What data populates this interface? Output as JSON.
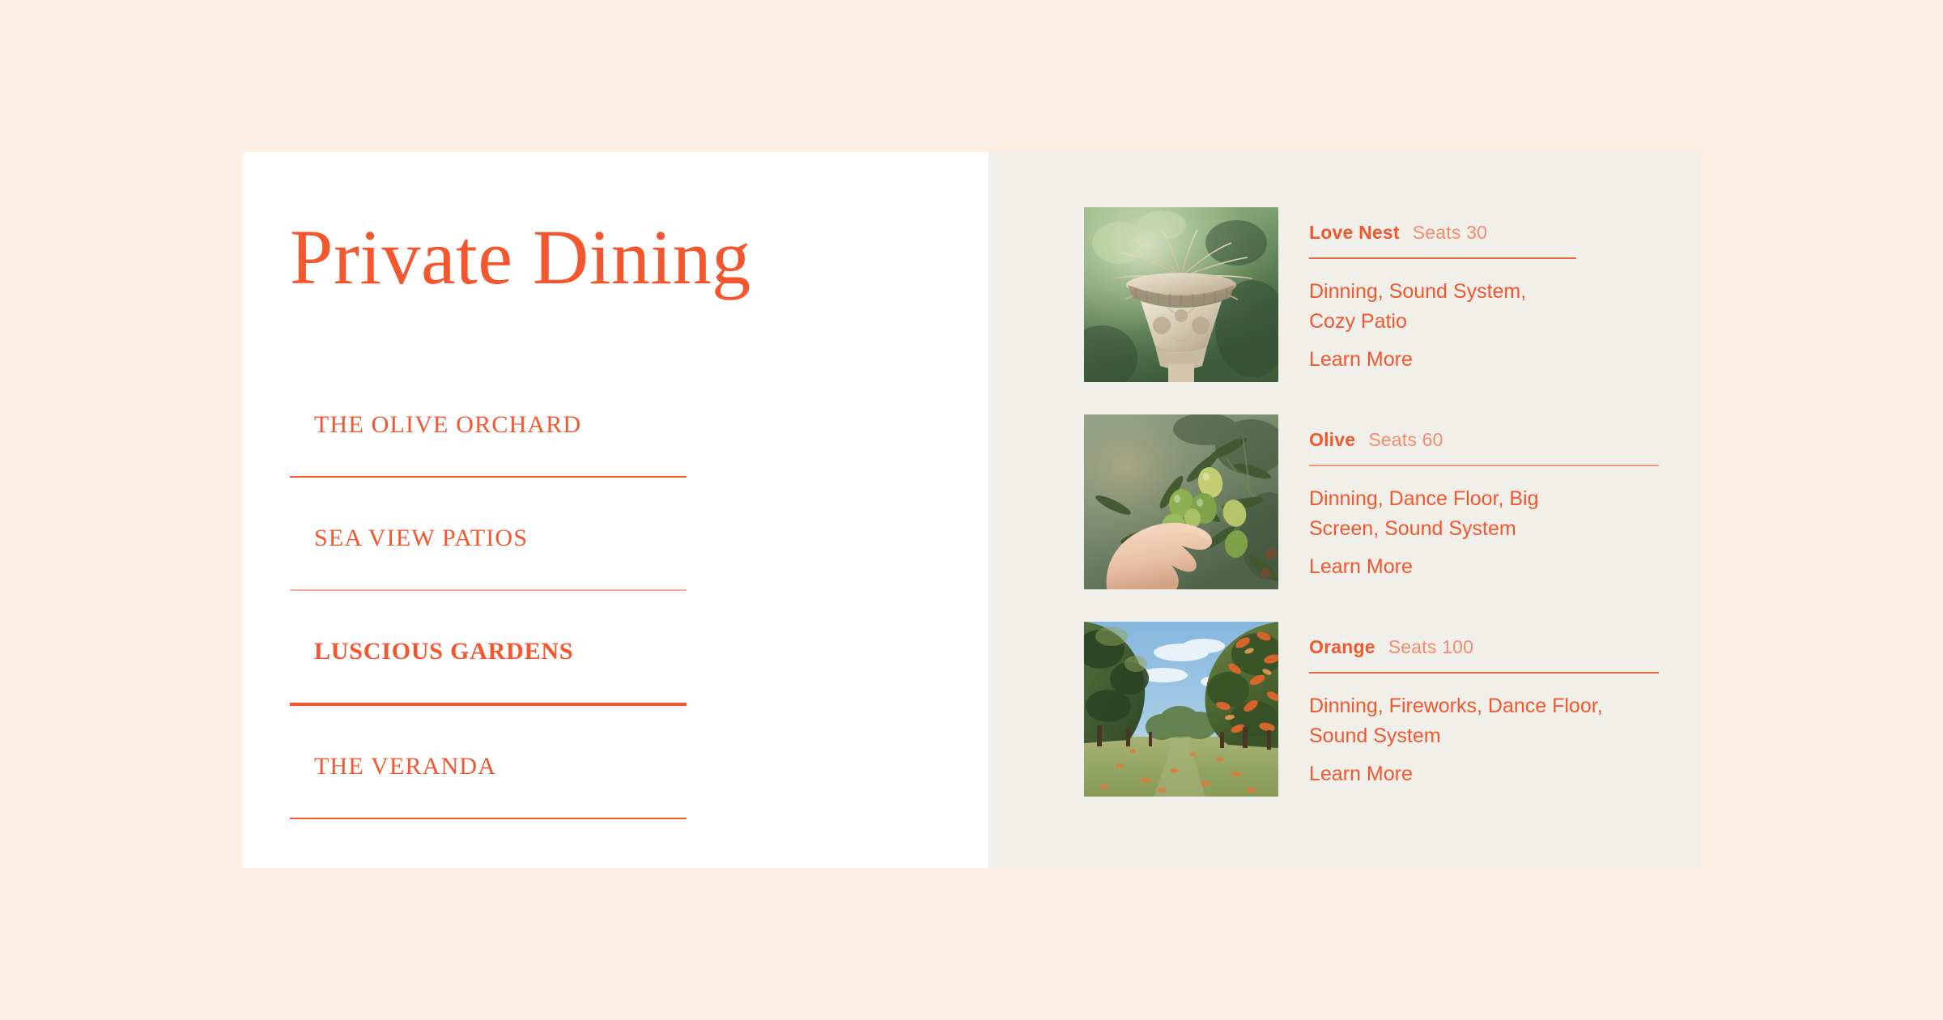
{
  "page": {
    "title": "Private Dining",
    "background_color": "#FDEEE4",
    "accent_color": "#F4562E"
  },
  "nav": {
    "items": [
      {
        "label": "THE OLIVE ORCHARD",
        "active": false
      },
      {
        "label": "SEA VIEW PATIOS",
        "active": false
      },
      {
        "label": "LUSCIOUS GARDENS",
        "active": true
      },
      {
        "label": "THE VERANDA",
        "active": false
      }
    ]
  },
  "cards": [
    {
      "name": "Love Nest",
      "seats": "Seats 30",
      "description": "Dinning, Sound System, Cozy Patio",
      "link_label": "Learn More",
      "image_name": "stone-urn-garden-photo"
    },
    {
      "name": "Olive",
      "seats": "Seats 60",
      "description": "Dinning, Dance Floor, Big Screen, Sound System",
      "link_label": "Learn More",
      "image_name": "hand-picking-olives-photo"
    },
    {
      "name": "Orange",
      "seats": "Seats 100",
      "description": "Dinning, Fireworks, Dance Floor, Sound System",
      "link_label": "Learn More",
      "image_name": "orange-orchard-path-photo"
    }
  ]
}
